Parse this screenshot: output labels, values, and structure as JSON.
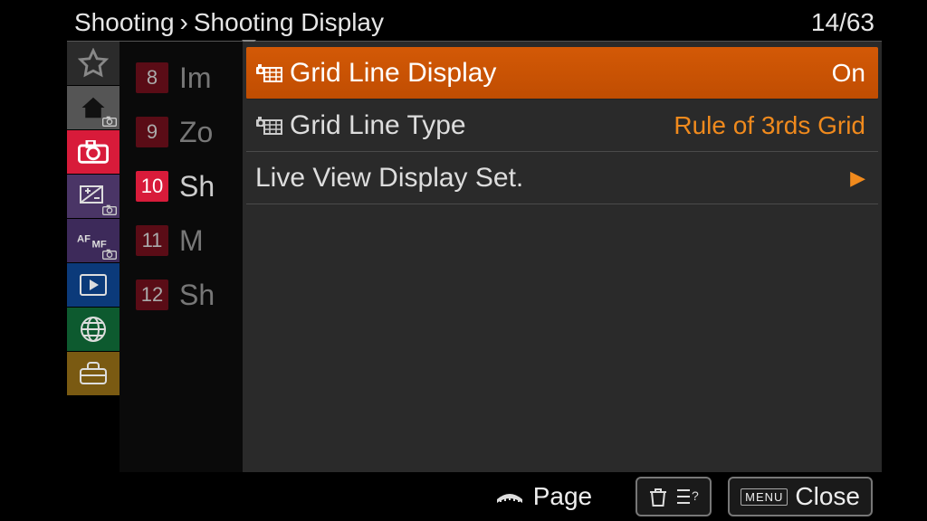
{
  "header": {
    "crumb1": "Shooting",
    "sep": "›",
    "crumb2": "Shooting Display",
    "pager": "14/63"
  },
  "sublist": [
    {
      "num": "8",
      "label": "Im"
    },
    {
      "num": "9",
      "label": "Zo"
    },
    {
      "num": "10",
      "label": "Sh",
      "active": true
    },
    {
      "num": "11",
      "label": "M"
    },
    {
      "num": "12",
      "label": "Sh"
    }
  ],
  "rows": {
    "grid_display": {
      "label": "Grid Line Display",
      "value": "On"
    },
    "grid_type": {
      "label": "Grid Line Type",
      "value": "Rule of 3rds Grid"
    },
    "liveview": {
      "label": "Live View Display Set."
    }
  },
  "footer": {
    "page": "Page",
    "close": "Close",
    "menu": "MENU"
  }
}
